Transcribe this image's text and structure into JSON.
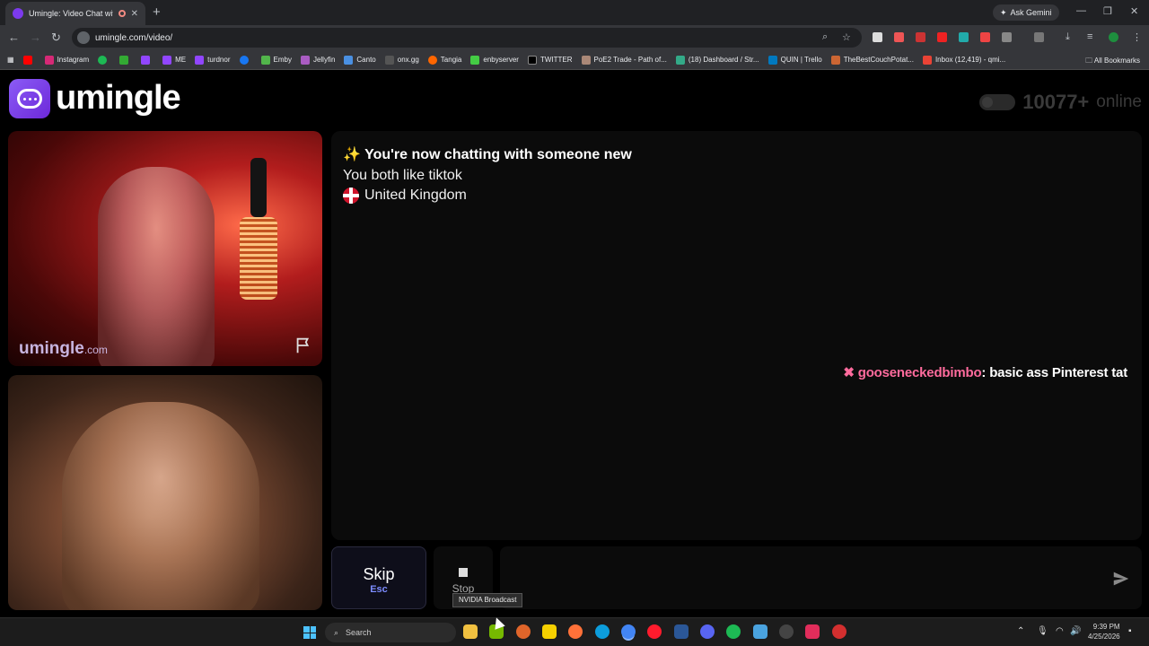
{
  "browser": {
    "tab_title": "Umingle: Video Chat with S",
    "new_tab": "+",
    "ask_gemini": "Ask Gemini",
    "url": "umingle.com/video/",
    "bookmarks": [
      "Instagram",
      "ME",
      "turdnor",
      "Emby",
      "Jellyfin",
      "Canto",
      "onx.gg",
      "Tangia",
      "enbyserver",
      "TWITTER",
      "PoE2 Trade - Path of...",
      "(18) Dashboard / Str...",
      "QUIN | Trello",
      "TheBestCouchPotat...",
      "Inbox (12,419) - qmi..."
    ],
    "all_bookmarks": "All Bookmarks",
    "colors": {
      "tabbar": "#202124",
      "toolbar": "#35363a"
    }
  },
  "header": {
    "logo_text": "umingle",
    "online_count": "10077+",
    "online_word": "online"
  },
  "videos": {
    "watermark_brand": "umingle",
    "watermark_suffix": ".com",
    "report_icon": "flag-icon"
  },
  "chat": {
    "line1_emoji": "✨",
    "line1_text": "You're now chatting with someone new",
    "line2": "You both like tiktok",
    "line3_country": "United Kingdom",
    "overlay_icon": "✖",
    "overlay_user": "gooseneckedbimbo",
    "overlay_sep": ":",
    "overlay_message": "basic ass Pinterest tat",
    "input_placeholder": ""
  },
  "controls": {
    "skip_label": "Skip",
    "skip_hint": "Esc",
    "stop_label": "Stop",
    "tooltip": "NVIDIA Broadcast",
    "send_icon": "send-icon"
  },
  "taskbar": {
    "search_label": "Search",
    "time": "9:39 PM",
    "date": "4/25/2026"
  },
  "theme": {
    "accent": "#8b5cf6",
    "background": "#000000",
    "panel": "#0b0b0b",
    "username_pink": "#ff6b9d"
  }
}
